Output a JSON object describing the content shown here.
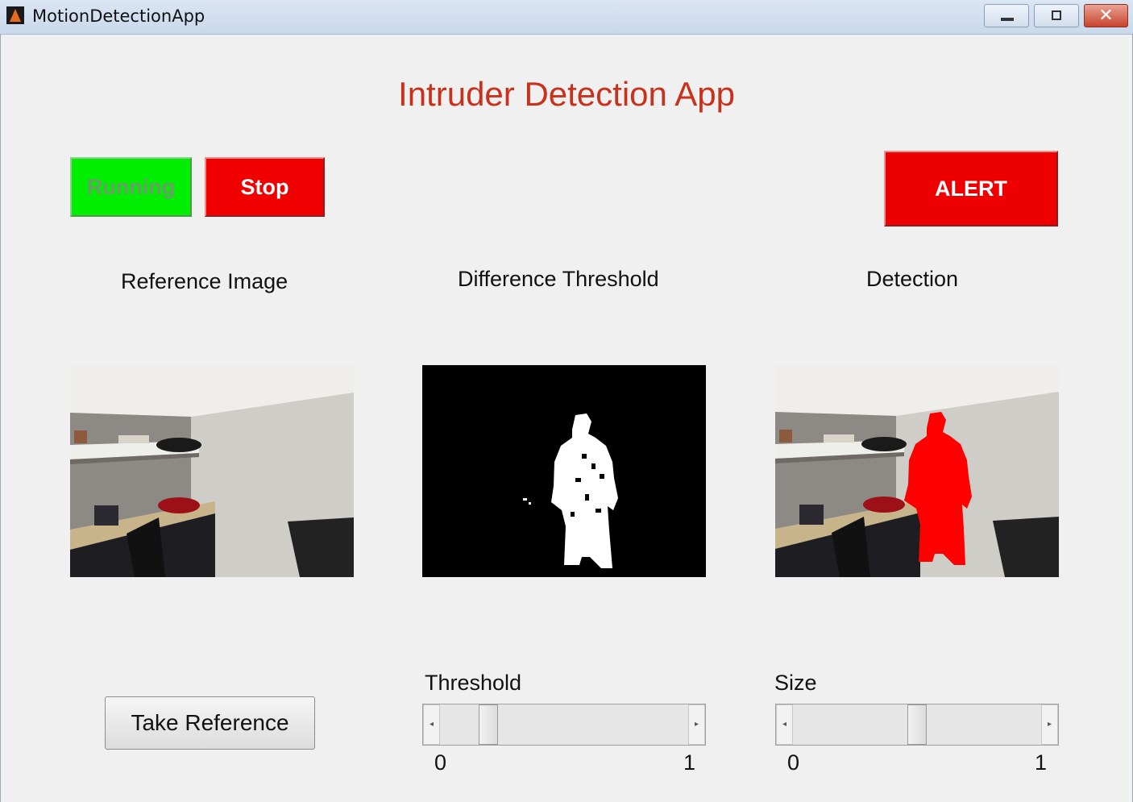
{
  "window": {
    "title": "MotionDetectionApp",
    "close_symbol": "✕"
  },
  "app": {
    "heading": "Intruder Detection App"
  },
  "buttons": {
    "running": "Running",
    "stop": "Stop",
    "alert": "ALERT",
    "take_reference": "Take Reference"
  },
  "panels": {
    "reference": "Reference Image",
    "difference": "Difference Threshold",
    "detection": "Detection"
  },
  "sliders": {
    "threshold": {
      "label": "Threshold",
      "min": "0",
      "max": "1",
      "value": 0.17
    },
    "size": {
      "label": "Size",
      "min": "0",
      "max": "1",
      "value": 0.5
    }
  },
  "colors": {
    "running": "#00ee00",
    "stop": "#f10000",
    "alert": "#ef0000",
    "heading": "#c8321c",
    "detection_overlay": "#ff0000"
  },
  "icons": {
    "app": "matlab-icon",
    "minimize": "minimize-icon",
    "maximize": "maximize-icon",
    "close": "close-icon",
    "arrow_left": "◂",
    "arrow_right": "▸"
  }
}
